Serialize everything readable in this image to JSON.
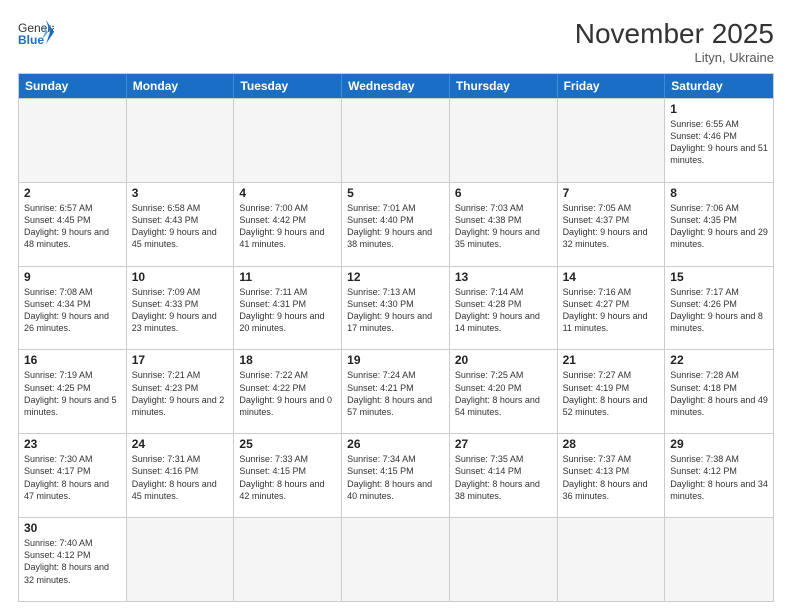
{
  "header": {
    "logo_general": "General",
    "logo_blue": "Blue",
    "month_title": "November 2025",
    "location": "Lityn, Ukraine"
  },
  "days_of_week": [
    "Sunday",
    "Monday",
    "Tuesday",
    "Wednesday",
    "Thursday",
    "Friday",
    "Saturday"
  ],
  "rows": [
    [
      {
        "day": "",
        "info": "",
        "empty": true
      },
      {
        "day": "",
        "info": "",
        "empty": true
      },
      {
        "day": "",
        "info": "",
        "empty": true
      },
      {
        "day": "",
        "info": "",
        "empty": true
      },
      {
        "day": "",
        "info": "",
        "empty": true
      },
      {
        "day": "",
        "info": "",
        "empty": true
      },
      {
        "day": "1",
        "info": "Sunrise: 6:55 AM\nSunset: 4:46 PM\nDaylight: 9 hours\nand 51 minutes."
      }
    ],
    [
      {
        "day": "2",
        "info": "Sunrise: 6:57 AM\nSunset: 4:45 PM\nDaylight: 9 hours\nand 48 minutes."
      },
      {
        "day": "3",
        "info": "Sunrise: 6:58 AM\nSunset: 4:43 PM\nDaylight: 9 hours\nand 45 minutes."
      },
      {
        "day": "4",
        "info": "Sunrise: 7:00 AM\nSunset: 4:42 PM\nDaylight: 9 hours\nand 41 minutes."
      },
      {
        "day": "5",
        "info": "Sunrise: 7:01 AM\nSunset: 4:40 PM\nDaylight: 9 hours\nand 38 minutes."
      },
      {
        "day": "6",
        "info": "Sunrise: 7:03 AM\nSunset: 4:38 PM\nDaylight: 9 hours\nand 35 minutes."
      },
      {
        "day": "7",
        "info": "Sunrise: 7:05 AM\nSunset: 4:37 PM\nDaylight: 9 hours\nand 32 minutes."
      },
      {
        "day": "8",
        "info": "Sunrise: 7:06 AM\nSunset: 4:35 PM\nDaylight: 9 hours\nand 29 minutes."
      }
    ],
    [
      {
        "day": "9",
        "info": "Sunrise: 7:08 AM\nSunset: 4:34 PM\nDaylight: 9 hours\nand 26 minutes."
      },
      {
        "day": "10",
        "info": "Sunrise: 7:09 AM\nSunset: 4:33 PM\nDaylight: 9 hours\nand 23 minutes."
      },
      {
        "day": "11",
        "info": "Sunrise: 7:11 AM\nSunset: 4:31 PM\nDaylight: 9 hours\nand 20 minutes."
      },
      {
        "day": "12",
        "info": "Sunrise: 7:13 AM\nSunset: 4:30 PM\nDaylight: 9 hours\nand 17 minutes."
      },
      {
        "day": "13",
        "info": "Sunrise: 7:14 AM\nSunset: 4:28 PM\nDaylight: 9 hours\nand 14 minutes."
      },
      {
        "day": "14",
        "info": "Sunrise: 7:16 AM\nSunset: 4:27 PM\nDaylight: 9 hours\nand 11 minutes."
      },
      {
        "day": "15",
        "info": "Sunrise: 7:17 AM\nSunset: 4:26 PM\nDaylight: 9 hours\nand 8 minutes."
      }
    ],
    [
      {
        "day": "16",
        "info": "Sunrise: 7:19 AM\nSunset: 4:25 PM\nDaylight: 9 hours\nand 5 minutes."
      },
      {
        "day": "17",
        "info": "Sunrise: 7:21 AM\nSunset: 4:23 PM\nDaylight: 9 hours\nand 2 minutes."
      },
      {
        "day": "18",
        "info": "Sunrise: 7:22 AM\nSunset: 4:22 PM\nDaylight: 9 hours\nand 0 minutes."
      },
      {
        "day": "19",
        "info": "Sunrise: 7:24 AM\nSunset: 4:21 PM\nDaylight: 8 hours\nand 57 minutes."
      },
      {
        "day": "20",
        "info": "Sunrise: 7:25 AM\nSunset: 4:20 PM\nDaylight: 8 hours\nand 54 minutes."
      },
      {
        "day": "21",
        "info": "Sunrise: 7:27 AM\nSunset: 4:19 PM\nDaylight: 8 hours\nand 52 minutes."
      },
      {
        "day": "22",
        "info": "Sunrise: 7:28 AM\nSunset: 4:18 PM\nDaylight: 8 hours\nand 49 minutes."
      }
    ],
    [
      {
        "day": "23",
        "info": "Sunrise: 7:30 AM\nSunset: 4:17 PM\nDaylight: 8 hours\nand 47 minutes."
      },
      {
        "day": "24",
        "info": "Sunrise: 7:31 AM\nSunset: 4:16 PM\nDaylight: 8 hours\nand 45 minutes."
      },
      {
        "day": "25",
        "info": "Sunrise: 7:33 AM\nSunset: 4:15 PM\nDaylight: 8 hours\nand 42 minutes."
      },
      {
        "day": "26",
        "info": "Sunrise: 7:34 AM\nSunset: 4:15 PM\nDaylight: 8 hours\nand 40 minutes."
      },
      {
        "day": "27",
        "info": "Sunrise: 7:35 AM\nSunset: 4:14 PM\nDaylight: 8 hours\nand 38 minutes."
      },
      {
        "day": "28",
        "info": "Sunrise: 7:37 AM\nSunset: 4:13 PM\nDaylight: 8 hours\nand 36 minutes."
      },
      {
        "day": "29",
        "info": "Sunrise: 7:38 AM\nSunset: 4:12 PM\nDaylight: 8 hours\nand 34 minutes."
      }
    ],
    [
      {
        "day": "30",
        "info": "Sunrise: 7:40 AM\nSunset: 4:12 PM\nDaylight: 8 hours\nand 32 minutes."
      },
      {
        "day": "",
        "info": "",
        "empty": true
      },
      {
        "day": "",
        "info": "",
        "empty": true
      },
      {
        "day": "",
        "info": "",
        "empty": true
      },
      {
        "day": "",
        "info": "",
        "empty": true
      },
      {
        "day": "",
        "info": "",
        "empty": true
      },
      {
        "day": "",
        "info": "",
        "empty": true
      }
    ]
  ]
}
